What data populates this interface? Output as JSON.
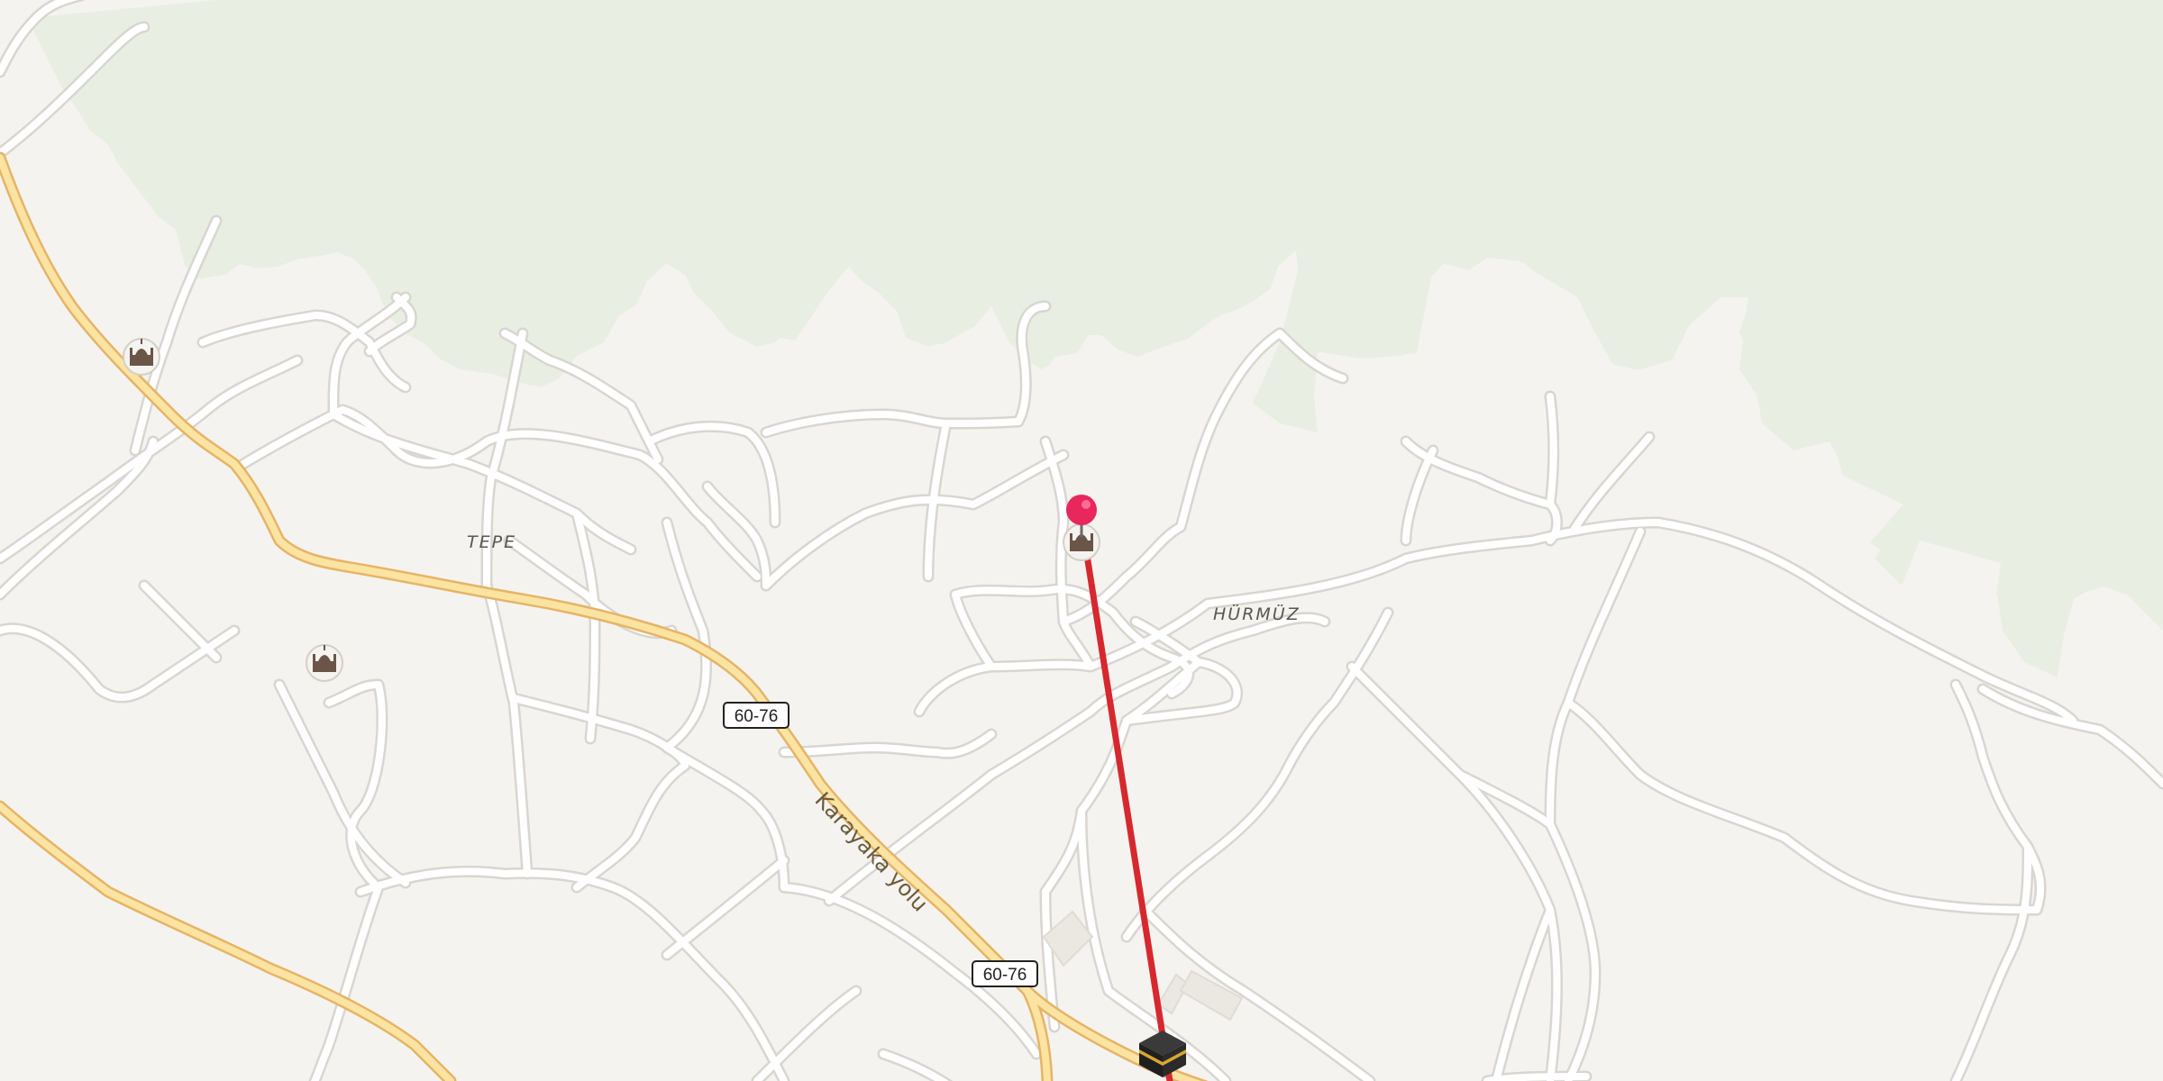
{
  "map": {
    "places": [
      {
        "id": "tepe",
        "label": "TEPE"
      },
      {
        "id": "hurmuz",
        "label": "HÜRMÜZ"
      }
    ],
    "road_labels": [
      {
        "id": "karayaka",
        "label": "Karayaka yolu"
      }
    ],
    "route_shields": [
      {
        "id": "shield-upper",
        "label": "60-76"
      },
      {
        "id": "shield-lower",
        "label": "60-76"
      }
    ],
    "pois": [
      {
        "id": "mosque-1",
        "icon": "mosque-icon"
      },
      {
        "id": "mosque-2",
        "icon": "mosque-icon"
      },
      {
        "id": "mosque-3",
        "icon": "mosque-icon"
      },
      {
        "id": "kaaba",
        "icon": "kaaba-icon"
      }
    ],
    "pin": {
      "icon": "location-pin-icon",
      "color": "#e8275c"
    },
    "qibla_line": {
      "color": "#d6282e"
    },
    "colors": {
      "background": "#f5f3ef",
      "forest": "#e9eee2",
      "main_road": "#fbe3a1",
      "main_road_casing": "#e6b467",
      "minor_road": "#ffffff"
    }
  }
}
